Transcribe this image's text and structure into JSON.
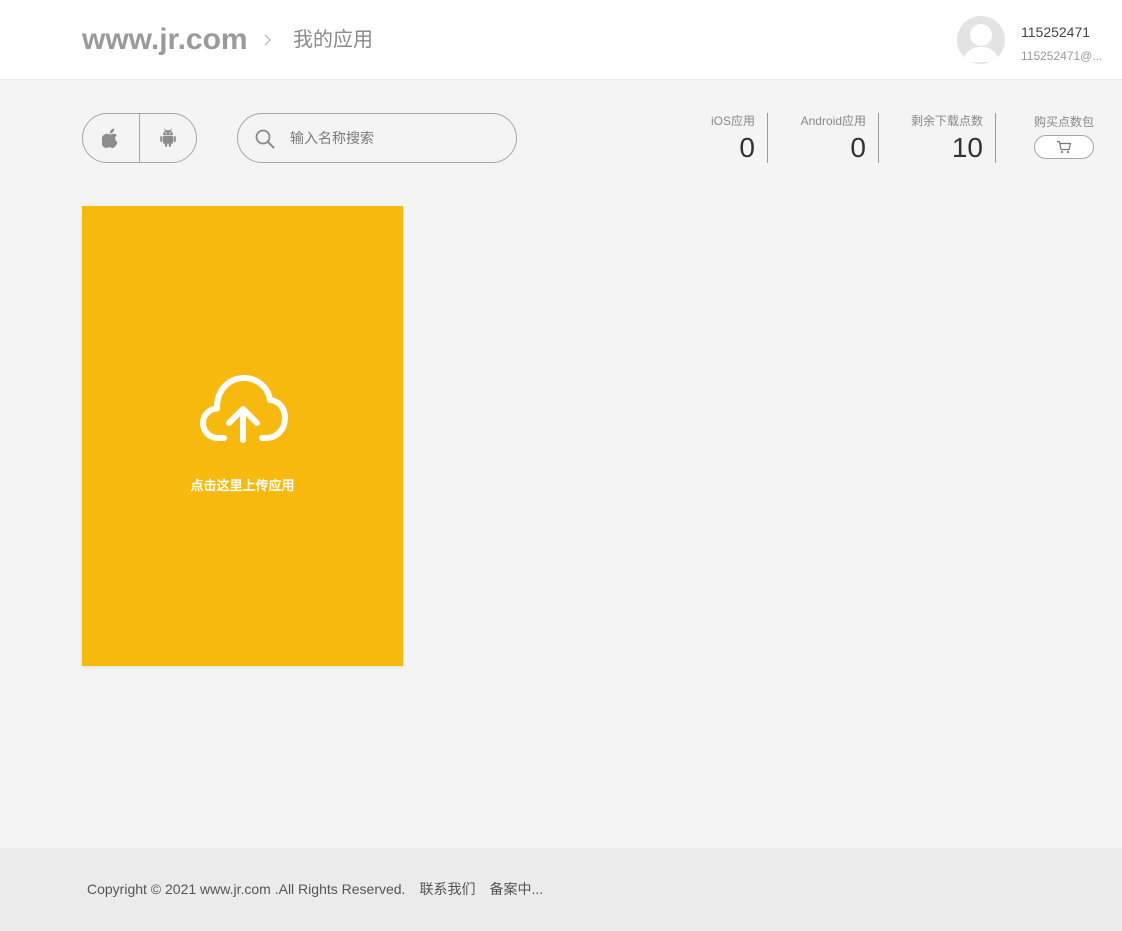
{
  "header": {
    "brand": "www.jr.com",
    "page_title": "我的应用",
    "user": {
      "name": "115252471",
      "email": "115252471@..."
    }
  },
  "toolbar": {
    "platforms": [
      {
        "name": "iOS",
        "icon": "apple-icon"
      },
      {
        "name": "Android",
        "icon": "android-icon"
      }
    ],
    "search": {
      "placeholder": "输入名称搜索",
      "value": ""
    }
  },
  "stats": {
    "ios_label": "iOS应用",
    "ios_value": "0",
    "android_label": "Android应用",
    "android_value": "0",
    "downloads_label": "剩余下载点数",
    "downloads_value": "10",
    "buy_label": "购买点数包",
    "buy_icon": "cart-icon"
  },
  "upload_card": {
    "label": "点击这里上传应用",
    "icon": "cloud-upload-icon",
    "color": "#f7b90e"
  },
  "footer": {
    "copyright": "Copyright © 2021 www.jr.com .All Rights Reserved.",
    "contact": "联系我们",
    "icp": "备案中..."
  }
}
